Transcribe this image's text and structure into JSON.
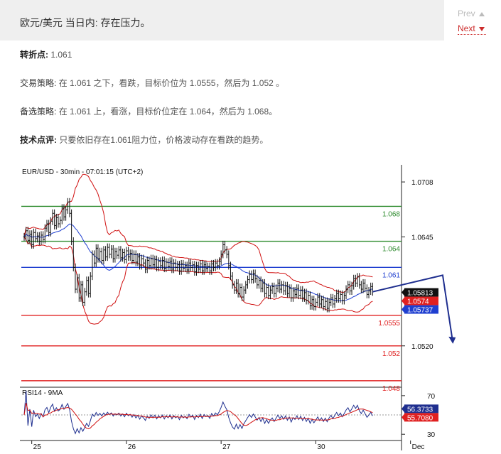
{
  "header": {
    "title": "欧元/美元 当日内: 存在压力。",
    "prev_label": "Prev",
    "next_label": "Next"
  },
  "analysis": {
    "pivot_label": "转折点:",
    "pivot_value": "1.061",
    "strategy_label": "交易策略:",
    "strategy_text": "在 1.061 之下，看跌，目标价位为 1.0555，然后为 1.052 。",
    "alt_label": "备选策略:",
    "alt_text": "在 1.061 上，看涨，目标价位定在 1.064，然后为 1.068。",
    "comment_label": "技术点评:",
    "comment_text": "只要依旧存在1.061阻力位，价格波动存在看跌的趋势。"
  },
  "chart_data": {
    "type": "line",
    "title": "EUR/USD - 30min - 07:01:15 (UTC+2)",
    "ylim": [
      1.0475,
      1.0726
    ],
    "y_ticks": [
      "1.0708",
      "1.0645",
      "1.0520"
    ],
    "y_tick_values": [
      1.0708,
      1.0645,
      1.052
    ],
    "x_ticks": [
      "25",
      "26",
      "27",
      "30",
      "Dec"
    ],
    "x_tick_index": [
      4,
      54,
      104,
      154,
      204
    ],
    "levels": [
      {
        "label": "1.068",
        "value": 1.068,
        "color": "#2e8b2e"
      },
      {
        "label": "1.064",
        "value": 1.064,
        "color": "#2e8b2e"
      },
      {
        "label": "1.061",
        "value": 1.061,
        "color": "#1f3fd0"
      },
      {
        "label": "1.0555",
        "value": 1.0555,
        "color": "#e02020"
      },
      {
        "label": "1.052",
        "value": 1.052,
        "color": "#e02020"
      },
      {
        "label": "1.048",
        "value": 1.048,
        "color": "#e02020"
      }
    ],
    "price_tags": [
      {
        "label": "1.05813",
        "value": 1.05813,
        "bg": "#111111"
      },
      {
        "label": "1.0574",
        "value": 1.0574,
        "bg": "#e02020"
      },
      {
        "label": "1.05737",
        "value": 1.05737,
        "bg": "#1f3fd0"
      }
    ],
    "forecast": {
      "from_index": 221,
      "from": 1.0601,
      "to_index": 226,
      "to": 1.0524,
      "color": "#1f2f8f"
    },
    "prices": [
      1.0645,
      1.0652,
      1.0641,
      1.0648,
      1.0636,
      1.065,
      1.0643,
      1.0646,
      1.064,
      1.0647,
      1.0642,
      1.0655,
      1.066,
      1.065,
      1.0663,
      1.0672,
      1.0658,
      1.0667,
      1.066,
      1.0664,
      1.0678,
      1.0668,
      1.0676,
      1.0685,
      1.0672,
      1.064,
      1.061,
      1.0585,
      1.0598,
      1.0575,
      1.059,
      1.057,
      1.0582,
      1.0595,
      1.058,
      1.06,
      1.0625,
      1.0615,
      1.0632,
      1.062,
      1.0628,
      1.0618,
      1.063,
      1.0622,
      1.0633,
      1.0625,
      1.0631,
      1.062,
      1.0628,
      1.0624,
      1.063,
      1.0621,
      1.0627,
      1.0619,
      1.0629,
      1.0622,
      1.0626,
      1.0618,
      1.0625,
      1.0616,
      1.0622,
      1.0612,
      1.062,
      1.0615,
      1.0608,
      1.0618,
      1.0612,
      1.062,
      1.0613,
      1.0619,
      1.061,
      1.0617,
      1.0612,
      1.0618,
      1.0609,
      1.0616,
      1.0611,
      1.0617,
      1.0608,
      1.0615,
      1.061,
      1.0613,
      1.0606,
      1.0614,
      1.0609,
      1.0612,
      1.0607,
      1.0615,
      1.061,
      1.0613,
      1.0605,
      1.0612,
      1.0608,
      1.0614,
      1.0606,
      1.0613,
      1.0609,
      1.0611,
      1.0606,
      1.0614,
      1.061,
      1.0615,
      1.0612,
      1.0617,
      1.0625,
      1.0636,
      1.063,
      1.0625,
      1.0612,
      1.06,
      1.059,
      1.0584,
      1.0592,
      1.058,
      1.0587,
      1.0576,
      1.0584,
      1.059,
      1.0596,
      1.0602,
      1.0596,
      1.0603,
      1.0597,
      1.059,
      1.0595,
      1.0586,
      1.0592,
      1.058,
      1.0587,
      1.0578,
      1.0584,
      1.0588,
      1.058,
      1.0586,
      1.0592,
      1.0585,
      1.059,
      1.0583,
      1.0589,
      1.058,
      1.0586,
      1.0575,
      1.0583,
      1.0579,
      1.0586,
      1.0578,
      1.0584,
      1.0575,
      1.0581,
      1.0572,
      1.0578,
      1.0566,
      1.0573,
      1.0565,
      1.057,
      1.0576,
      1.0568,
      1.0573,
      1.0565,
      1.0571,
      1.0563,
      1.057,
      1.0575,
      1.0568,
      1.0574,
      1.058,
      1.0574,
      1.0579,
      1.0572,
      1.0578,
      1.0585,
      1.059,
      1.0583,
      1.0589,
      1.0597,
      1.0592,
      1.0599,
      1.059,
      1.0585,
      1.0592,
      1.0586,
      1.0579,
      1.0583,
      1.0588,
      1.0582
    ],
    "rsi": {
      "label": "RSI14 - 9MA",
      "ylim": [
        25,
        78
      ],
      "ticks": [
        70,
        30
      ],
      "tags": [
        {
          "label": "56.3733",
          "value": 56.3733,
          "bg": "#1f2f8f"
        },
        {
          "label": "55.7080",
          "value": 55.708,
          "bg": "#e02020"
        }
      ]
    }
  }
}
